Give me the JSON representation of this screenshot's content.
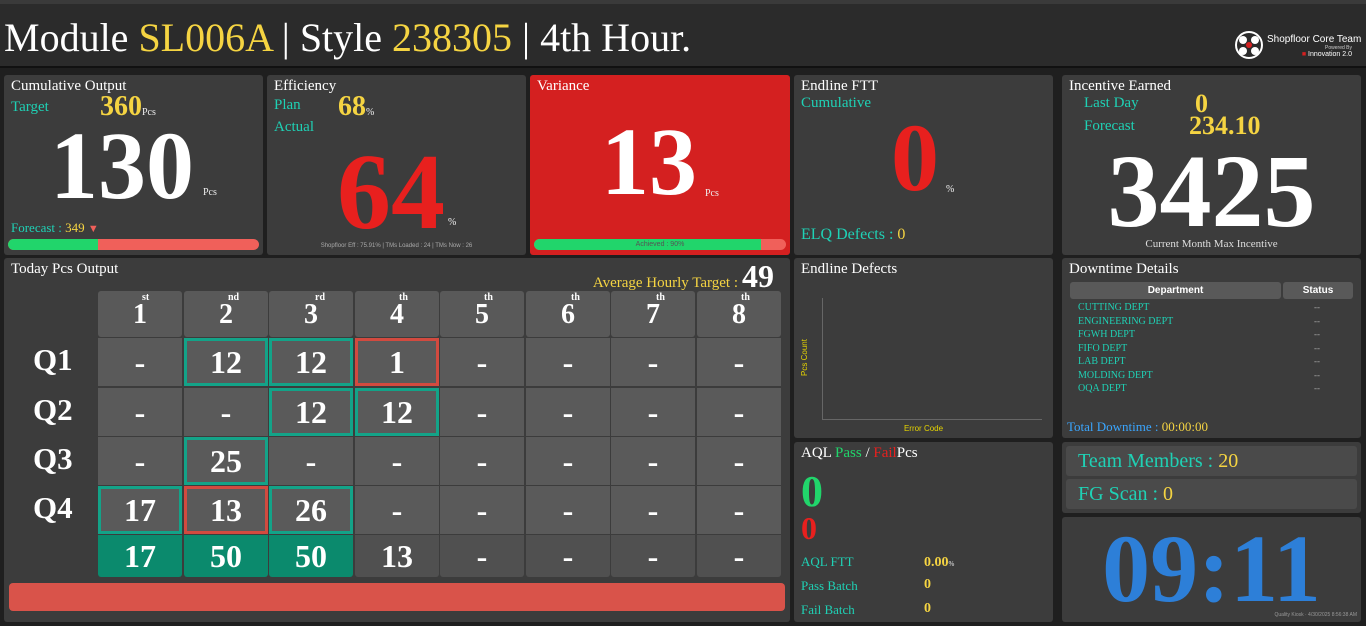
{
  "header": {
    "module_label": "Module",
    "module_value": "SL006A",
    "style_label": "Style",
    "style_value": "238305",
    "hour_label": "4th Hour.",
    "brand_name": "Shopfloor Core Team",
    "brand_powered": "Powered By",
    "brand_innovation": "Innovation 2.0"
  },
  "cumulative": {
    "title": "Cumulative Output",
    "target_label": "Target",
    "target_value": "360",
    "target_unit": "Pcs",
    "value": "130",
    "value_unit": "Pcs",
    "forecast_label": "Forecast :",
    "forecast_value": "349",
    "forecast_arrow": "▼",
    "progress_fraction": 0.36
  },
  "efficiency": {
    "title": "Efficiency",
    "plan_label": "Plan",
    "plan_value": "68",
    "plan_unit": "%",
    "actual_label": "Actual",
    "value": "64",
    "value_unit": "%",
    "footer": "Shopfloor Eff : 75.91% | TMs Loaded : 24 | TMs Now : 26"
  },
  "variance": {
    "title": "Variance",
    "value": "13",
    "value_unit": "Pcs",
    "bar_label": "Achieved : 90%",
    "progress_fraction": 0.9
  },
  "endline_ftt": {
    "title": "Endline FTT",
    "cumulative_label": "Cumulative",
    "value": "0",
    "value_unit": "%",
    "elq_label": "ELQ Defects :",
    "elq_value": "0"
  },
  "incentive": {
    "title": "Incentive Earned",
    "last_day_label": "Last Day",
    "last_day_value": "0",
    "forecast_label": "Forecast",
    "forecast_value": "234.10",
    "value": "3425",
    "caption": "Current Month Max Incentive"
  },
  "today": {
    "title": "Today Pcs Output",
    "avg_target_label": "Average Hourly Target :",
    "avg_target_value": "49",
    "hours": [
      {
        "num": "1",
        "sup": "st"
      },
      {
        "num": "2",
        "sup": "nd"
      },
      {
        "num": "3",
        "sup": "rd"
      },
      {
        "num": "4",
        "sup": "th"
      },
      {
        "num": "5",
        "sup": "th"
      },
      {
        "num": "6",
        "sup": "th"
      },
      {
        "num": "7",
        "sup": "th"
      },
      {
        "num": "8",
        "sup": "th"
      }
    ],
    "rows": [
      {
        "label": "Q1",
        "cells": [
          "-",
          "12",
          "12",
          "1",
          "-",
          "-",
          "-",
          "-"
        ],
        "status": [
          "",
          "g",
          "g",
          "r",
          "",
          "",
          "",
          ""
        ]
      },
      {
        "label": "Q2",
        "cells": [
          "-",
          "-",
          "12",
          "12",
          "-",
          "-",
          "-",
          "-"
        ],
        "status": [
          "",
          "",
          "g",
          "g",
          "",
          "",
          "",
          ""
        ]
      },
      {
        "label": "Q3",
        "cells": [
          "-",
          "25",
          "-",
          "-",
          "-",
          "-",
          "-",
          "-"
        ],
        "status": [
          "",
          "g",
          "",
          "",
          "",
          "",
          "",
          ""
        ]
      },
      {
        "label": "Q4",
        "cells": [
          "17",
          "13",
          "26",
          "-",
          "-",
          "-",
          "-",
          "-"
        ],
        "status": [
          "g",
          "r",
          "g",
          "",
          "",
          "",
          "",
          ""
        ]
      }
    ],
    "totals": [
      "17",
      "50",
      "50",
      "13",
      "-",
      "-",
      "-",
      "-"
    ],
    "totals_status": [
      "tot",
      "tot",
      "tot",
      "totn",
      "totn",
      "totn",
      "totn",
      "totn"
    ]
  },
  "endline_defects": {
    "title": "Endline Defects",
    "ylabel": "Pcs Count",
    "xlabel": "Error Code"
  },
  "downtime": {
    "title": "Downtime Details",
    "col_department": "Department",
    "col_status": "Status",
    "rows": [
      {
        "dept": "CUTTING DEPT",
        "status": "--"
      },
      {
        "dept": "ENGINEERING DEPT",
        "status": "--"
      },
      {
        "dept": "FGWH DEPT",
        "status": "--"
      },
      {
        "dept": "FIFO DEPT",
        "status": "--"
      },
      {
        "dept": "LAB DEPT",
        "status": "--"
      },
      {
        "dept": "MOLDING DEPT",
        "status": "--"
      },
      {
        "dept": "OQA DEPT",
        "status": "--"
      }
    ],
    "total_label": "Total Downtime :",
    "total_value": "00:00:00"
  },
  "aql": {
    "title_prefix": "AQL",
    "pass_label": "Pass",
    "slash": "/",
    "fail_label": "Fail",
    "pcs_label": "Pcs",
    "pass_value": "0",
    "fail_value": "0",
    "ftt_label": "AQL FTT",
    "ftt_value": "0.00",
    "ftt_unit": "%",
    "pass_batch_label": "Pass Batch",
    "pass_batch_value": "0",
    "fail_batch_label": "Fail Batch",
    "fail_batch_value": "0"
  },
  "team": {
    "members_label": "Team Members :",
    "members_value": "20",
    "fg_label": "FG Scan :",
    "fg_value": "0"
  },
  "clock": {
    "time": "09:11",
    "footer": "Quality Kiosk · 4/30/2025 8:56:38 AM"
  },
  "colors": {
    "teal": "#1fd1b5",
    "yellow": "#f5d442",
    "red": "#e8201e",
    "green_cell": "#0b8a6d",
    "blue_clock": "#2d7fd8",
    "variance_bg": "#d42020"
  }
}
